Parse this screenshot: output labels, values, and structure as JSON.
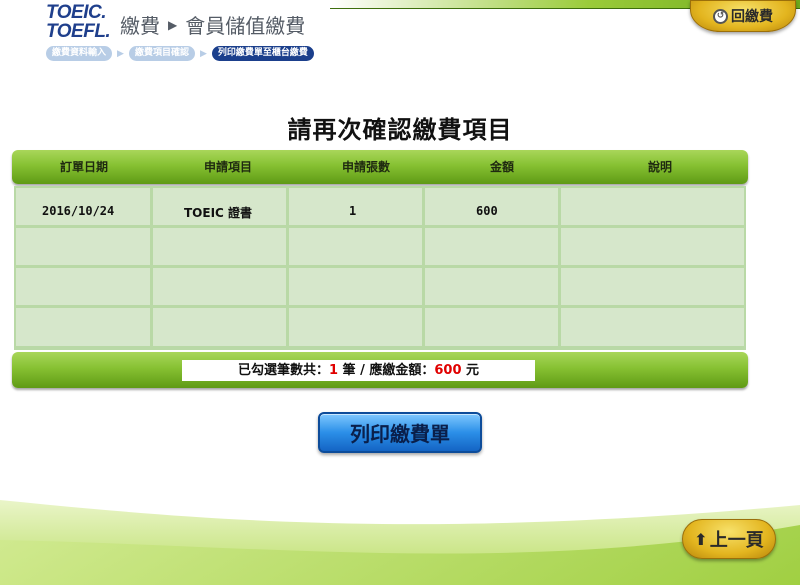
{
  "logo": {
    "line1": "TOEIC.",
    "line2": "TOEFL."
  },
  "header": {
    "section": "繳費",
    "subsection": "會員儲值繳費",
    "back_to_pay": "回繳費"
  },
  "breadcrumb": {
    "steps": [
      "繳費資料輸入",
      "繳費項目確認",
      "列印繳費單至櫃台繳費"
    ]
  },
  "page": {
    "heading": "請再次確認繳費項目"
  },
  "table": {
    "columns": [
      "訂單日期",
      "申請項目",
      "申請張數",
      "金額",
      "說明"
    ],
    "rows": [
      [
        "2016/10/24",
        "TOEIC 證書",
        "1",
        "600",
        ""
      ],
      [
        "",
        "",
        "",
        "",
        ""
      ],
      [
        "",
        "",
        "",
        "",
        ""
      ],
      [
        "",
        "",
        "",
        "",
        ""
      ]
    ]
  },
  "summary": {
    "prefix": "已勾選筆數共：",
    "count": "1",
    "mid": " 筆 / 應繳金額：",
    "amount": "600",
    "suffix": " 元"
  },
  "actions": {
    "print": "列印繳費單",
    "prev": "上一頁"
  },
  "colors": {
    "green_bar": "#86c132",
    "cell_bg": "#d6e7cb",
    "accent_red": "#e00000",
    "print_button": "#2b8fe8",
    "gold_button": "#e3b51f",
    "brand_blue": "#1f3f8c"
  }
}
